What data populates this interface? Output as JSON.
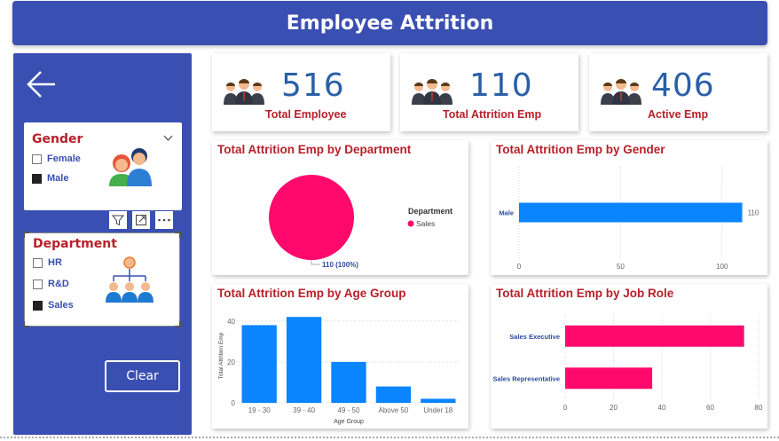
{
  "header": {
    "title": "Employee Attrition"
  },
  "sidebar": {
    "gender_slicer": {
      "title": "Gender",
      "options": [
        {
          "label": "Female",
          "checked": false
        },
        {
          "label": "Male",
          "checked": true
        }
      ]
    },
    "department_slicer": {
      "title": "Department",
      "options": [
        {
          "label": "HR",
          "checked": false
        },
        {
          "label": "R&D",
          "checked": false
        },
        {
          "label": "Sales",
          "checked": true
        }
      ]
    },
    "toolbar_icons": [
      "filter-icon",
      "focus-mode-icon",
      "more-options-icon"
    ],
    "clear_label": "Clear"
  },
  "kpis": [
    {
      "value": "516",
      "label": "Total Employee"
    },
    {
      "value": "110",
      "label": "Total Attrition Emp"
    },
    {
      "value": "406",
      "label": "Active Emp"
    }
  ],
  "colors": {
    "header": "#3a4fb2",
    "title_red": "#b8202a",
    "bar_blue": "#0a84ff",
    "pink": "#ff0a6c",
    "kpi_blue": "#2b5fa8"
  },
  "chart_data": [
    {
      "type": "pie",
      "title": "Total Attrition Emp by Department",
      "legend_title": "Department",
      "categories": [
        "Sales"
      ],
      "values": [
        110
      ],
      "data_labels": [
        "110 (100%)"
      ],
      "colors": [
        "#ff0a6c"
      ],
      "legend": "right"
    },
    {
      "type": "bar",
      "orientation": "horizontal",
      "title": "Total Attrition Emp by Gender",
      "categories": [
        "Male"
      ],
      "values": [
        110
      ],
      "data_labels": [
        "110"
      ],
      "xlim": [
        0,
        115
      ],
      "xticks": [
        0,
        50,
        100
      ],
      "grid": true
    },
    {
      "type": "bar",
      "title": "Total Attrition Emp by Age Group",
      "categories": [
        "19 - 30",
        "39 - 40",
        "49 - 50",
        "Above 50",
        "Under 18"
      ],
      "values": [
        38,
        42,
        20,
        8,
        2
      ],
      "xlabel": "Age Group",
      "ylabel": "Total Attrition Emp",
      "ylim": [
        0,
        46
      ],
      "yticks": [
        0,
        20,
        40
      ],
      "grid": true
    },
    {
      "type": "bar",
      "orientation": "horizontal",
      "title": "Total Attrition Emp by Job Role",
      "categories": [
        "Sales Executive",
        "Sales Representative"
      ],
      "values": [
        74,
        36
      ],
      "xlim": [
        0,
        80
      ],
      "xticks": [
        0,
        20,
        40,
        60,
        80
      ],
      "grid": true
    }
  ]
}
